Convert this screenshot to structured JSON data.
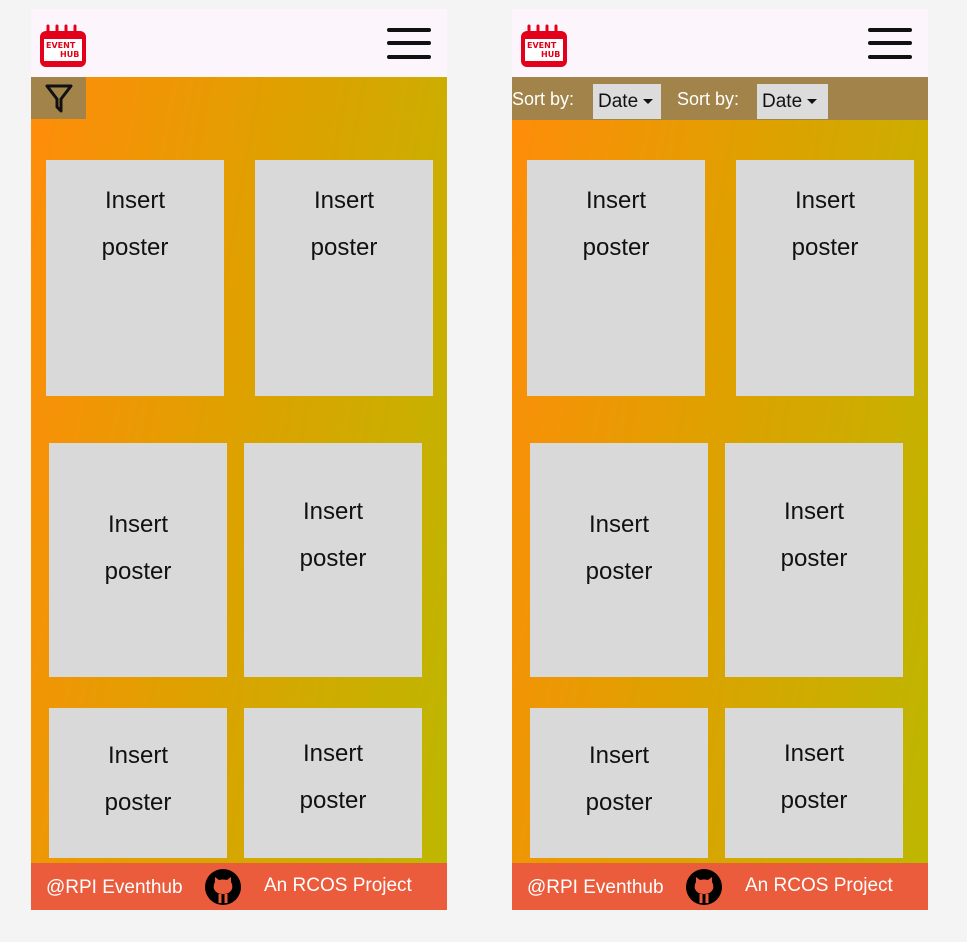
{
  "header": {
    "logo_top": "EVENT",
    "logo_bottom": "HUB"
  },
  "sort": {
    "label1": "Sort by:",
    "value1": "Date",
    "label2": "Sort by:",
    "value2": "Date"
  },
  "poster": {
    "line1": "Insert",
    "line2": "poster"
  },
  "footer": {
    "handle": "@RPI Eventhub",
    "project": "An RCOS Project"
  },
  "colors": {
    "header_bg": "#fcf6fc",
    "gradient_start": "#ff8c0a",
    "gradient_end": "#bdb700",
    "filter_bar": "#a2834a",
    "card": "#d9d9d9",
    "footer": "#ea5c3b",
    "logo_red": "#e2001a"
  }
}
